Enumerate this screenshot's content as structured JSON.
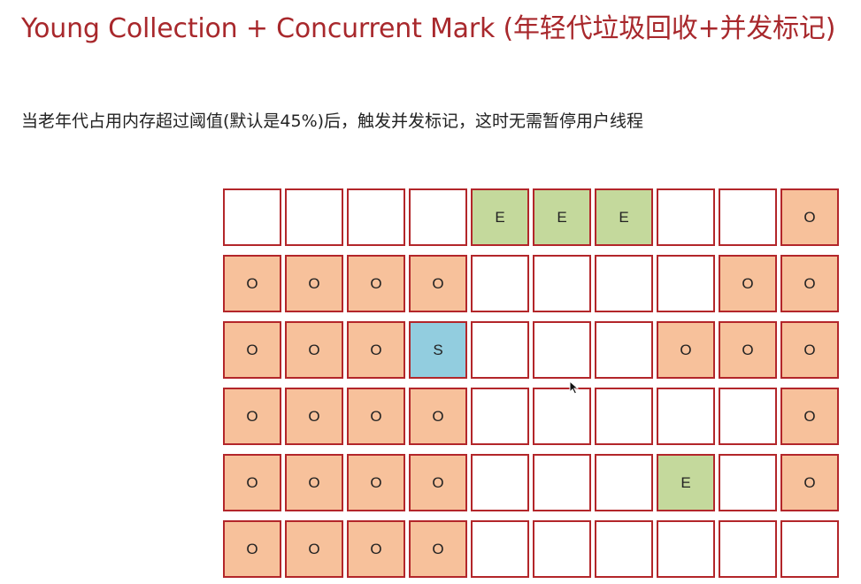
{
  "slide": {
    "title": "Young Collection + Concurrent Mark (年轻代垃圾回收+并发标记)",
    "subtitle": "当老年代占用内存超过阈值(默认是45%)后，触发并发标记，这时无需暂停用户线程"
  },
  "region_grid": {
    "rows": [
      [
        "",
        "",
        "",
        "",
        "E",
        "E",
        "E",
        "",
        "",
        "O"
      ],
      [
        "O",
        "O",
        "O",
        "O",
        "",
        "",
        "",
        "",
        "O",
        "O"
      ],
      [
        "O",
        "O",
        "O",
        "S",
        "",
        "",
        "",
        "O",
        "O",
        "O"
      ],
      [
        "O",
        "O",
        "O",
        "O",
        "",
        "",
        "",
        "",
        "",
        "O"
      ],
      [
        "O",
        "O",
        "O",
        "O",
        "",
        "",
        "",
        "E",
        "",
        "O"
      ],
      [
        "O",
        "O",
        "O",
        "O",
        "",
        "",
        "",
        "",
        "",
        ""
      ]
    ]
  },
  "colors": {
    "title": "#a8282c",
    "cell_border": "#b3262a",
    "old_region": "#f7c19b",
    "eden_region": "#c4d99c",
    "survivor_region": "#92cddf",
    "free_region": "#ffffff"
  },
  "icons": {
    "cursor": "mouse-pointer-icon"
  }
}
